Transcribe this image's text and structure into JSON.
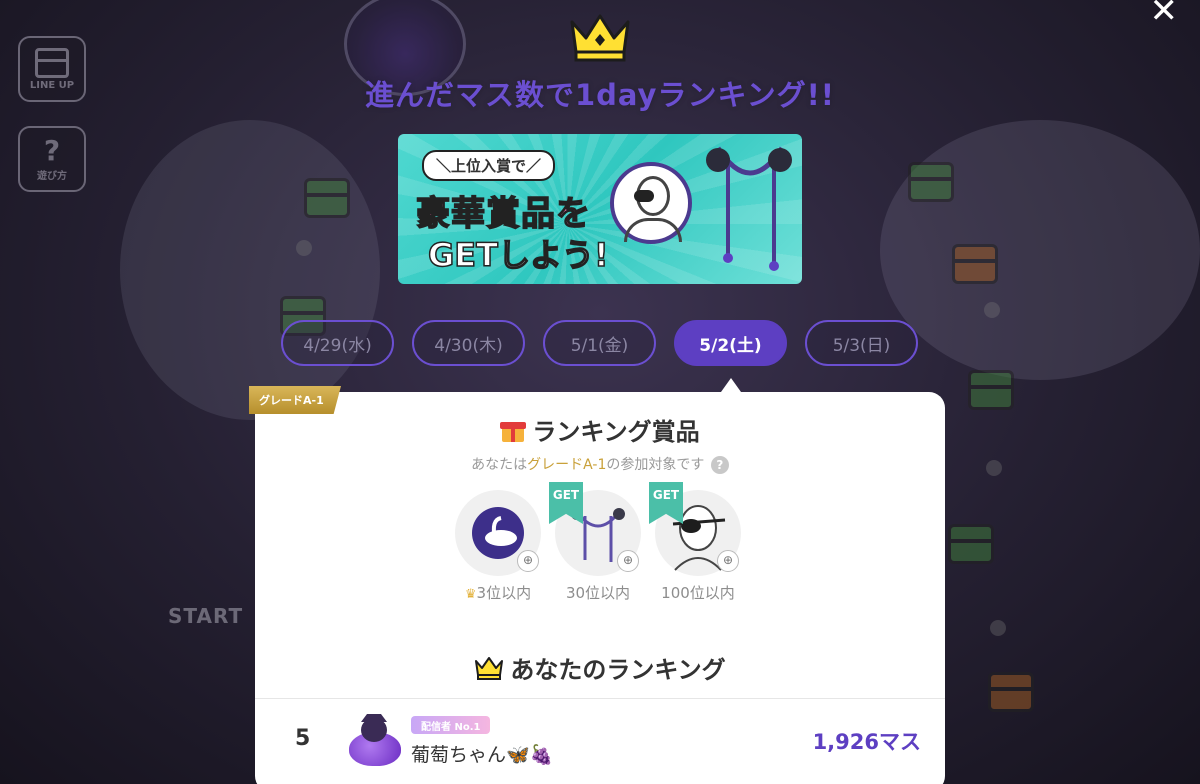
{
  "side_buttons": {
    "lineup_label": "LINE UP",
    "howto_glyph": "?",
    "howto_label": "遊び方"
  },
  "close_glyph": "✕",
  "background": {
    "start_label": "START"
  },
  "headline": "進んだマス数で1dayランキング!!",
  "banner": {
    "sub": "＼上位入賞で／",
    "title_line1": "豪華賞品を",
    "title_line2": "GETしよう!"
  },
  "date_tabs": [
    {
      "label": "4/29(水)",
      "active": false
    },
    {
      "label": "4/30(木)",
      "active": false
    },
    {
      "label": "5/1(金)",
      "active": false
    },
    {
      "label": "5/2(土)",
      "active": true
    },
    {
      "label": "5/3(日)",
      "active": false
    }
  ],
  "grade_ribbon": "グレードA-1",
  "prizes_section": {
    "title": "ランキング賞品",
    "eligibility_prefix": "あなたは",
    "eligibility_grade": "グレードA-1",
    "eligibility_suffix": "の参加対象です",
    "help_glyph": "?",
    "items": [
      {
        "label": "3位以内",
        "get": false,
        "icon": "swan-teacup-icon"
      },
      {
        "label": "30位以内",
        "get": true,
        "get_text": "GET",
        "icon": "chandelier-icon"
      },
      {
        "label": "100位以内",
        "get": true,
        "get_text": "GET",
        "icon": "eyepatch-avatar-icon"
      }
    ]
  },
  "my_ranking": {
    "title": "あなたのランキング",
    "rank": "5",
    "badge_text": "配信者 No.1",
    "name": "葡萄ちゃん🦋🍇",
    "score": "1,926マス"
  },
  "colors": {
    "accent": "#5d3fc2",
    "headline": "#6b4fd1",
    "grade_gold": "#c9a13a",
    "get_badge": "#4bbfa8"
  }
}
